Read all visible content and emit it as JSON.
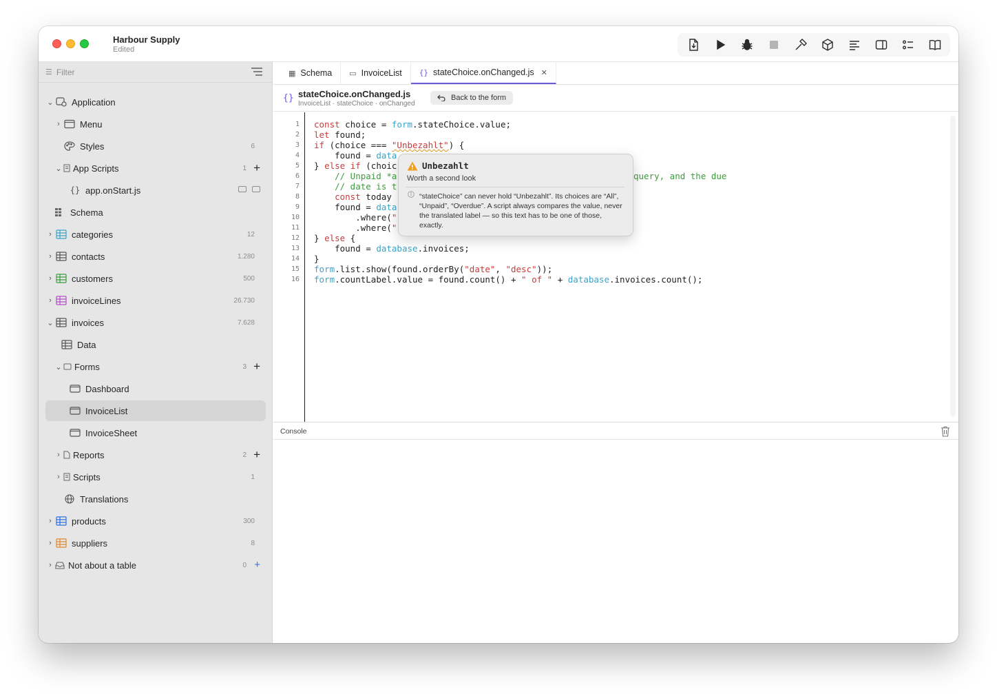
{
  "window": {
    "title": "Harbour Supply",
    "subtitle": "Edited"
  },
  "toolbar": {
    "buttons": [
      "export-icon",
      "play-icon",
      "bug-icon",
      "stop-icon",
      "hammer-icon",
      "cube-icon",
      "lines-icon",
      "panel-icon",
      "checklist-icon",
      "book-icon"
    ]
  },
  "sidebar": {
    "filter_placeholder": "Filter",
    "items": [
      {
        "label": "Application",
        "count": ""
      },
      {
        "label": "Menu",
        "count": ""
      },
      {
        "label": "Styles",
        "count": "6"
      },
      {
        "label": "App Scripts",
        "count": "1"
      },
      {
        "label": "app.onStart.js",
        "count": ""
      },
      {
        "label": "Schema",
        "count": ""
      },
      {
        "label": "categories",
        "count": "12"
      },
      {
        "label": "contacts",
        "count": "1.280"
      },
      {
        "label": "customers",
        "count": "500"
      },
      {
        "label": "invoiceLines",
        "count": "26.730"
      },
      {
        "label": "invoices",
        "count": "7.628"
      },
      {
        "label": "Data",
        "count": ""
      },
      {
        "label": "Forms",
        "count": "3"
      },
      {
        "label": "Dashboard",
        "count": ""
      },
      {
        "label": "InvoiceList",
        "count": ""
      },
      {
        "label": "InvoiceSheet",
        "count": ""
      },
      {
        "label": "Reports",
        "count": "2"
      },
      {
        "label": "Scripts",
        "count": "1"
      },
      {
        "label": "Translations",
        "count": ""
      },
      {
        "label": "products",
        "count": "300"
      },
      {
        "label": "suppliers",
        "count": "8"
      },
      {
        "label": "Not about a table",
        "count": "0"
      }
    ],
    "table_colors": {
      "categories": "#3aa3c7",
      "contacts": "#555555",
      "customers": "#3d9b3d",
      "invoiceLines": "#b14fc5",
      "invoices": "#555555",
      "products": "#2f6fe0",
      "suppliers": "#e08a2f"
    }
  },
  "tabs": [
    {
      "label": "Schema",
      "active": false
    },
    {
      "label": "InvoiceList",
      "active": false
    },
    {
      "label": "stateChoice.onChanged.js",
      "active": true
    }
  ],
  "editor": {
    "filename": "stateChoice.onChanged.js",
    "path": "InvoiceList · stateChoice · onChanged",
    "back_label": "Back to the form",
    "line_numbers": [
      "1",
      "2",
      "3",
      "4",
      "5",
      "6",
      "7",
      "8",
      "9",
      "10",
      "11",
      "12",
      "13",
      "14",
      "15",
      "16"
    ],
    "lines": {
      "l1a": "const",
      "l1b": " choice = ",
      "l1c": "form",
      "l1d": ".stateChoice.value;",
      "l2a": "let",
      "l2b": " found;",
      "l3a": "if",
      "l3b": " (choice === ",
      "l3c": "\"Unbezahlt\"",
      "l3d": ") {",
      "l4a": "    found = ",
      "l4b": "data",
      "l5a": "} ",
      "l5b": "else if",
      "l5c": " (choic",
      "l6a": "    // Unpaid *a",
      "l6b": "query, and the due",
      "l7a": "    // date is t",
      "l8a": "    ",
      "l8b": "const",
      "l8c": " today",
      "l9a": "    found = ",
      "l9b": "data",
      "l10a": "        .where(",
      "l10b": "\"",
      "l11a": "        .where(",
      "l11b": "\"",
      "l12a": "} ",
      "l12b": "else",
      "l12c": " {",
      "l13a": "    found = ",
      "l13b": "database",
      "l13c": ".invoices;",
      "l14a": "}",
      "l15a": "form",
      "l15b": ".list.show(found.orderBy(",
      "l15c": "\"date\"",
      "l15d": ", ",
      "l15e": "\"desc\"",
      "l15f": "));",
      "l16a": "form",
      "l16b": ".countLabel.value = found.count() + ",
      "l16c": "\" of \"",
      "l16d": " + ",
      "l16e": "database",
      "l16f": ".invoices.count();"
    }
  },
  "console": {
    "label": "Console"
  },
  "popover": {
    "title": "Unbezahlt",
    "subtitle": "Worth a second look",
    "body": "“stateChoice” can never hold “Unbezahlt”. Its choices are “All”, “Unpaid”, “Overdue”. A script always compares the value, never the translated label — so this text has to be one of those, exactly."
  }
}
